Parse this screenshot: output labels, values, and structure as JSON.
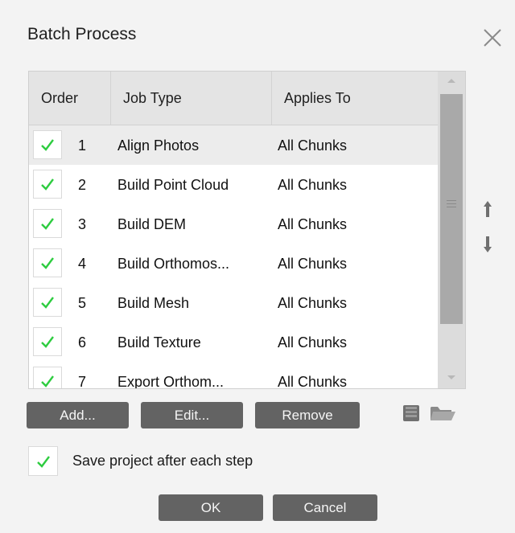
{
  "dialog": {
    "title": "Batch Process",
    "close_icon": "close-icon"
  },
  "table": {
    "columns": [
      "Order",
      "Job Type",
      "Applies To"
    ],
    "rows": [
      {
        "checked": true,
        "order": "1",
        "job": "Align Photos",
        "applies": "All Chunks"
      },
      {
        "checked": true,
        "order": "2",
        "job": "Build Point Cloud",
        "applies": "All Chunks"
      },
      {
        "checked": true,
        "order": "3",
        "job": "Build DEM",
        "applies": "All Chunks"
      },
      {
        "checked": true,
        "order": "4",
        "job": "Build Orthomos...",
        "applies": "All Chunks"
      },
      {
        "checked": true,
        "order": "5",
        "job": "Build Mesh",
        "applies": "All Chunks"
      },
      {
        "checked": true,
        "order": "6",
        "job": "Build Texture",
        "applies": "All Chunks"
      },
      {
        "checked": true,
        "order": "7",
        "job": "Export Orthom...",
        "applies": "All Chunks"
      }
    ]
  },
  "buttons": {
    "add": "Add...",
    "edit": "Edit...",
    "remove": "Remove",
    "ok": "OK",
    "cancel": "Cancel"
  },
  "options": {
    "save_project": "Save project after each step",
    "save_project_checked": true
  },
  "colors": {
    "check": "#2ecc40",
    "button_bg": "#636363",
    "header_bg": "#e4e4e4"
  },
  "icons": [
    "close-icon",
    "move-up-arrow-icon",
    "move-down-arrow-icon",
    "save-icon",
    "open-folder-icon",
    "checkmark-icon"
  ]
}
